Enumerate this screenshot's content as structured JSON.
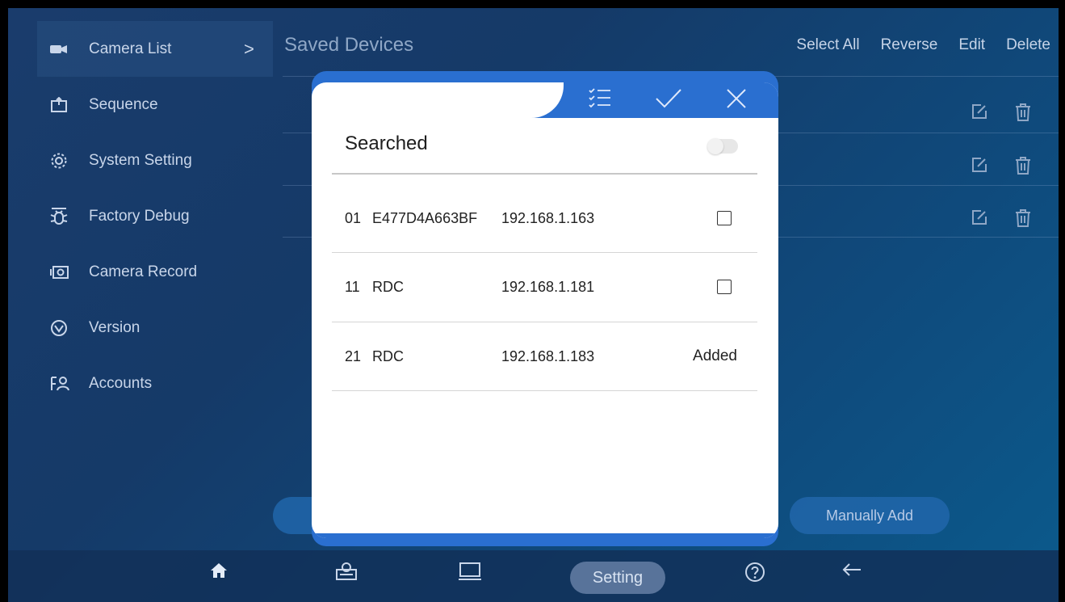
{
  "sidebar": {
    "items": [
      {
        "label": "Camera List",
        "icon": "camera-icon",
        "active": true,
        "chevron": ">"
      },
      {
        "label": "Sequence",
        "icon": "sequence-icon"
      },
      {
        "label": "System Setting",
        "icon": "gear-icon"
      },
      {
        "label": "Factory Debug",
        "icon": "bug-icon"
      },
      {
        "label": "Camera Record",
        "icon": "record-icon"
      },
      {
        "label": "Version",
        "icon": "version-icon"
      },
      {
        "label": "Accounts",
        "icon": "accounts-icon"
      }
    ]
  },
  "header": {
    "title": "Saved Devices",
    "actions": [
      "Select All",
      "Reverse",
      "Edit",
      "Delete"
    ]
  },
  "buttons": {
    "manually_add": "Manually Add"
  },
  "bottom_nav": {
    "items": [
      "home-icon",
      "user-card-icon",
      "monitor-icon",
      "Setting",
      "help-icon",
      "back-arrow-icon"
    ],
    "setting_label": "Setting"
  },
  "modal": {
    "title": "Searched",
    "toggle_on": false,
    "devices": [
      {
        "num": "01",
        "name": "E477D4A663BF",
        "ip": "192.168.1.163",
        "status": "checkbox",
        "checked": false
      },
      {
        "num": "11",
        "name": "RDC",
        "ip": "192.168.1.181",
        "status": "checkbox",
        "checked": false
      },
      {
        "num": "21",
        "name": "RDC",
        "ip": "192.168.1.183",
        "status": "Added"
      }
    ]
  },
  "colors": {
    "accent": "#2a6fd0",
    "background": "#153a68",
    "sidebar_text": "#c9d6ea"
  }
}
